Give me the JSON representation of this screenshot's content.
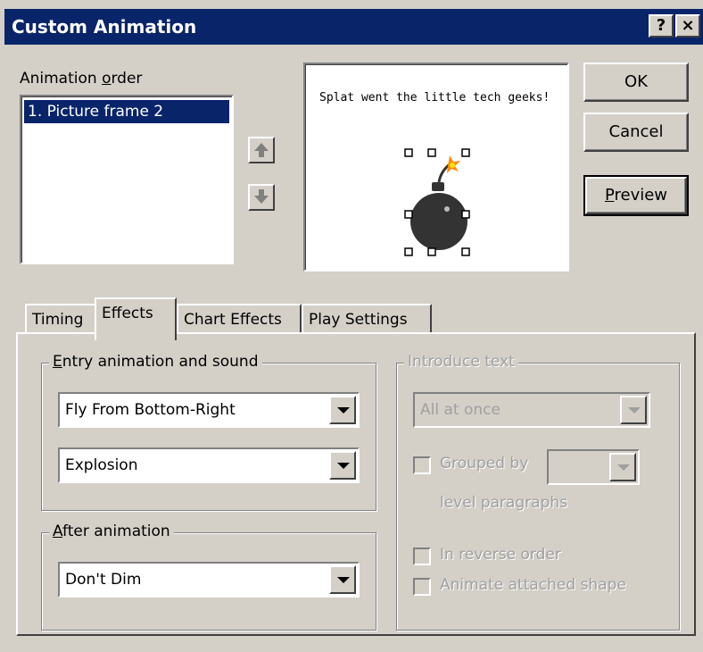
{
  "window": {
    "title": "Custom Animation",
    "help_button": "?",
    "close_button": "×"
  },
  "animation_order": {
    "label": "Animation order",
    "items": [
      "1. Picture frame 2"
    ],
    "selected_index": 0
  },
  "preview": {
    "caption": "Splat went the little tech geeks!",
    "image": "bomb-icon"
  },
  "buttons": {
    "ok": "OK",
    "cancel": "Cancel",
    "preview": "Preview"
  },
  "tabs": [
    {
      "label": "Timing",
      "active": false
    },
    {
      "label": "Effects",
      "active": true
    },
    {
      "label": "Chart Effects",
      "active": false
    },
    {
      "label": "Play Settings",
      "active": false
    }
  ],
  "entry": {
    "group_label": "Entry animation and sound",
    "effect_value": "Fly From Bottom-Right",
    "sound_value": "Explosion"
  },
  "after": {
    "group_label": "After animation",
    "value": "Don't Dim"
  },
  "introduce_text": {
    "group_label": "Introduce text",
    "value": "All at once",
    "grouped_by_label": "Grouped by",
    "level_label": "level paragraphs",
    "reverse_label": "In reverse order",
    "attached_label": "Animate attached shape",
    "enabled": false
  },
  "colors": {
    "title_bar": "#0a246a",
    "face": "#d4d0c8",
    "selection": "#0a246a",
    "disabled_text": "#a0a0a0"
  }
}
